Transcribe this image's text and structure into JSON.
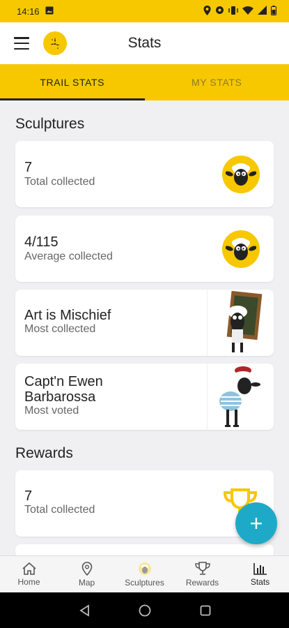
{
  "status_bar": {
    "time": "14:16"
  },
  "app_bar": {
    "title": "Stats"
  },
  "tabs": [
    {
      "label": "TRAIL STATS",
      "active": true
    },
    {
      "label": "MY STATS",
      "active": false
    }
  ],
  "sections": {
    "sculptures_title": "Sculptures",
    "rewards_title": "Rewards"
  },
  "sculpture_cards": [
    {
      "value": "7",
      "label": "Total collected",
      "icon": "sheep-icon"
    },
    {
      "value": "4/115",
      "label": "Average collected",
      "icon": "sheep-icon"
    },
    {
      "value": "Art is Mischief",
      "label": "Most collected",
      "icon": "sculpture-framed-sheep"
    },
    {
      "value_line1": "Capt'n Ewen",
      "value_line2": "Barbarossa",
      "label": "Most voted",
      "icon": "sculpture-pirate-sheep"
    }
  ],
  "reward_cards": [
    {
      "value": "7",
      "label": "Total collected",
      "icon": "trophy-icon"
    }
  ],
  "fab": {
    "label": "+"
  },
  "bottom_nav": [
    {
      "label": "Home",
      "icon": "home-icon"
    },
    {
      "label": "Map",
      "icon": "map-pin-icon"
    },
    {
      "label": "Sculptures",
      "icon": "sheep-icon"
    },
    {
      "label": "Rewards",
      "icon": "trophy-icon"
    },
    {
      "label": "Stats",
      "icon": "bar-chart-icon",
      "active": true
    }
  ],
  "colors": {
    "brand_yellow": "#f7c800",
    "fab_blue": "#1fa9c9"
  }
}
